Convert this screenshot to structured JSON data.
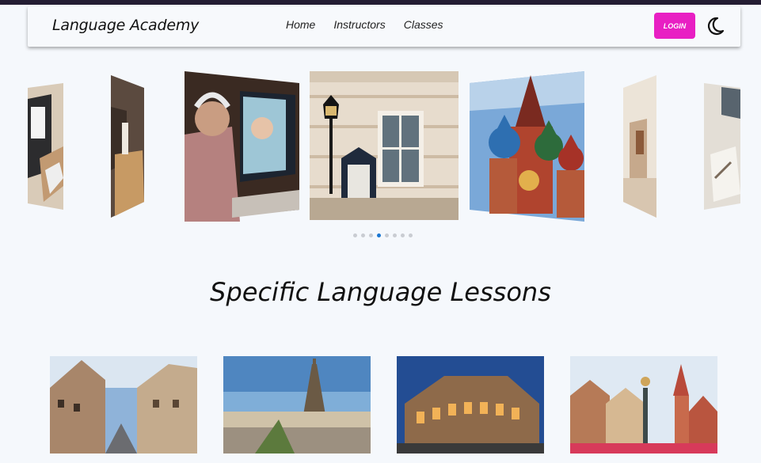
{
  "header": {
    "brand": "Language Academy",
    "nav": [
      "Home",
      "Instructors",
      "Classes"
    ],
    "login_label": "LOGIN",
    "theme_icon": "moon-icon"
  },
  "carousel": {
    "slides": [
      "laptop-desk-photo",
      "people-photo",
      "headphones-video-call-photo",
      "london-building-photo",
      "moscow-st-basils-photo",
      "classroom-photo",
      "writing-desk-photo"
    ],
    "dot_count": 8,
    "active_dot": 3
  },
  "main": {
    "section_title": "Specific Language Lessons",
    "lessons": [
      "madrid-street-photo",
      "paris-eiffel-photo",
      "rome-colosseum-photo",
      "frankfurt-square-photo"
    ]
  },
  "colors": {
    "accent": "#e81fc3",
    "active_dot": "#1976d2",
    "background": "#f5f8fc",
    "topbar": "#241d33"
  }
}
